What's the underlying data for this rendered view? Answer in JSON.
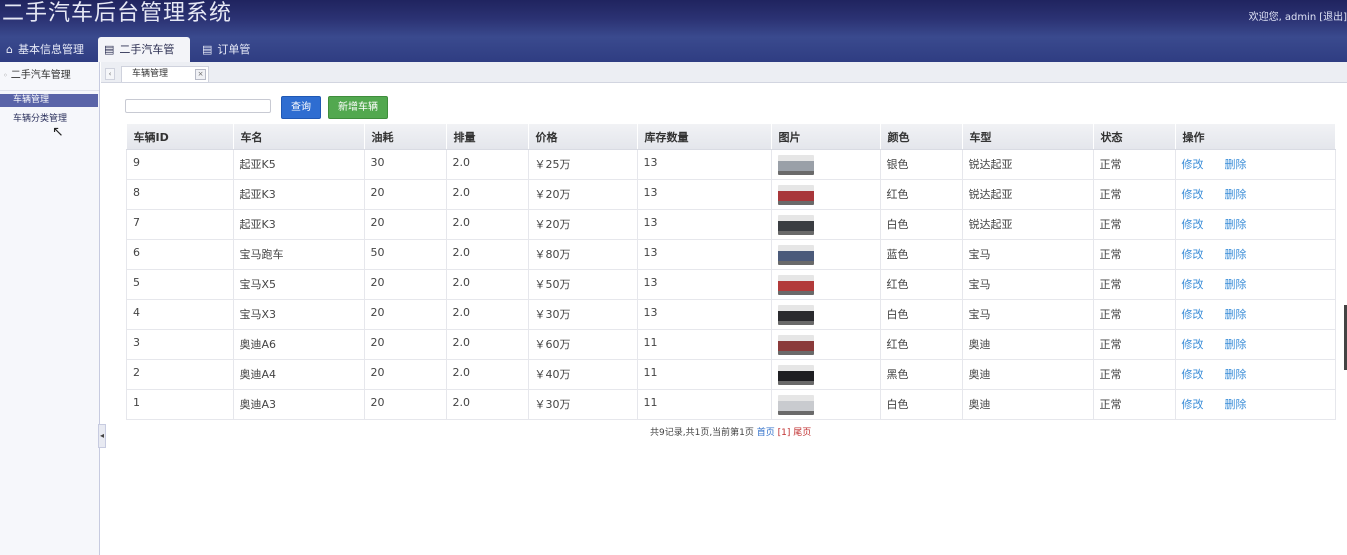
{
  "header": {
    "title": "二手汽车后台管理系统",
    "welcome_prefix": "欢迎您,",
    "user": "admin",
    "logout": "[退出]"
  },
  "topnav": [
    {
      "label": "基本信息管理",
      "icon": "home-icon"
    },
    {
      "label": "二手汽车管理",
      "icon": "list-icon"
    },
    {
      "label": "订单管理",
      "icon": "list-icon"
    }
  ],
  "sidebar": {
    "title": "二手汽车管理",
    "items": [
      {
        "label": "车辆管理"
      },
      {
        "label": "车辆分类管理"
      }
    ]
  },
  "content_tab": {
    "label": "车辆管理"
  },
  "toolbar": {
    "search_value": "",
    "query_label": "查询",
    "add_label": "新增车辆"
  },
  "table": {
    "headers": [
      "车辆ID",
      "车名",
      "油耗",
      "排量",
      "价格",
      "库存数量",
      "图片",
      "颜色",
      "车型",
      "状态",
      "操作"
    ],
    "rows": [
      {
        "id": "9",
        "name": "起亚K5",
        "fuel": "30",
        "disp": "2.0",
        "price": "￥25万",
        "stock": "13",
        "color": "银色",
        "type": "锐达起亚",
        "status": "正常",
        "img": "#9aa0a8"
      },
      {
        "id": "8",
        "name": "起亚K3",
        "fuel": "20",
        "disp": "2.0",
        "price": "￥20万",
        "stock": "13",
        "color": "红色",
        "type": "锐达起亚",
        "status": "正常",
        "img": "#a8363a"
      },
      {
        "id": "7",
        "name": "起亚K3",
        "fuel": "20",
        "disp": "2.0",
        "price": "￥20万",
        "stock": "13",
        "color": "白色",
        "type": "锐达起亚",
        "status": "正常",
        "img": "#3a3d42"
      },
      {
        "id": "6",
        "name": "宝马跑车",
        "fuel": "50",
        "disp": "2.0",
        "price": "￥80万",
        "stock": "13",
        "color": "蓝色",
        "type": "宝马",
        "status": "正常",
        "img": "#4b5a7a"
      },
      {
        "id": "5",
        "name": "宝马X5",
        "fuel": "20",
        "disp": "2.0",
        "price": "￥50万",
        "stock": "13",
        "color": "红色",
        "type": "宝马",
        "status": "正常",
        "img": "#b23a3a"
      },
      {
        "id": "4",
        "name": "宝马X3",
        "fuel": "20",
        "disp": "2.0",
        "price": "￥30万",
        "stock": "13",
        "color": "白色",
        "type": "宝马",
        "status": "正常",
        "img": "#2a2a2e"
      },
      {
        "id": "3",
        "name": "奥迪A6",
        "fuel": "20",
        "disp": "2.0",
        "price": "￥60万",
        "stock": "11",
        "color": "红色",
        "type": "奥迪",
        "status": "正常",
        "img": "#8a3a3a"
      },
      {
        "id": "2",
        "name": "奥迪A4",
        "fuel": "20",
        "disp": "2.0",
        "price": "￥40万",
        "stock": "11",
        "color": "黑色",
        "type": "奥迪",
        "status": "正常",
        "img": "#1e1e22"
      },
      {
        "id": "1",
        "name": "奥迪A3",
        "fuel": "20",
        "disp": "2.0",
        "price": "￥30万",
        "stock": "11",
        "color": "白色",
        "type": "奥迪",
        "status": "正常",
        "img": "#c9cbcf"
      }
    ],
    "edit_label": "修改",
    "delete_label": "删除"
  },
  "pager": {
    "summary": "共9记录,共1页,当前第1页",
    "first": "首页",
    "current": "[1]",
    "last": "尾页"
  }
}
